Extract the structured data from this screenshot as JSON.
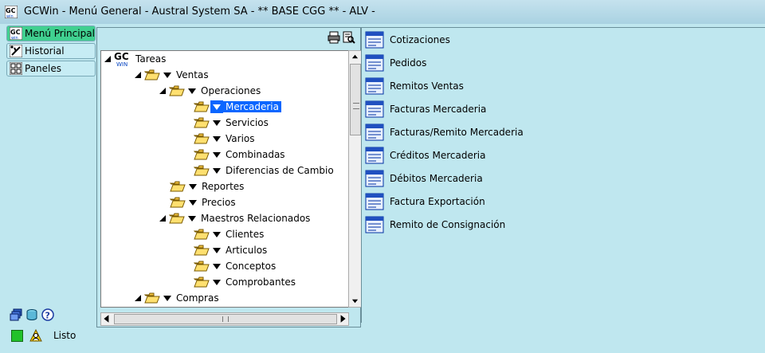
{
  "window": {
    "title": "GCWin - Menú General - Austral System SA - ** BASE CGG ** - ALV -"
  },
  "nav": [
    {
      "label": "Menú Principal",
      "icon": "gcwin-logo-icon",
      "active": true
    },
    {
      "label": "Historial",
      "icon": "history-icon",
      "active": false
    },
    {
      "label": "Paneles",
      "icon": "panels-grid-icon",
      "active": false
    }
  ],
  "tree": {
    "nodes": [
      {
        "label": "Tareas",
        "level": 0
      },
      {
        "label": "Ventas",
        "level": 1
      },
      {
        "label": "Operaciones",
        "level": 2
      },
      {
        "label": "Mercaderia",
        "level": 3
      },
      {
        "label": "Servicios",
        "level": 3
      },
      {
        "label": "Varios",
        "level": 3
      },
      {
        "label": "Combinadas",
        "level": 3
      },
      {
        "label": "Diferencias de Cambio",
        "level": 3
      },
      {
        "label": "Reportes",
        "level": 2
      },
      {
        "label": "Precios",
        "level": 2
      },
      {
        "label": "Maestros Relacionados",
        "level": 2
      },
      {
        "label": "Clientes",
        "level": 3
      },
      {
        "label": "Articulos",
        "level": 3
      },
      {
        "label": "Conceptos",
        "level": 3
      },
      {
        "label": "Comprobantes",
        "level": 3
      },
      {
        "label": "Compras",
        "level": 1
      }
    ],
    "selected": "Mercaderia"
  },
  "list": {
    "items": [
      "Cotizaciones",
      "Pedidos",
      "Remitos Ventas",
      "Facturas Mercaderia",
      "Facturas/Remito Mercaderia",
      "Créditos Mercaderia",
      "Débitos Mercaderia",
      "Factura Exportación",
      "Remito de Consignación"
    ]
  },
  "status": {
    "text": "Listo"
  },
  "colors": {
    "background": "#bfe7ef",
    "nav_active": "#40d090",
    "selection": "#0a66ff",
    "status_ok": "#22c22a"
  }
}
